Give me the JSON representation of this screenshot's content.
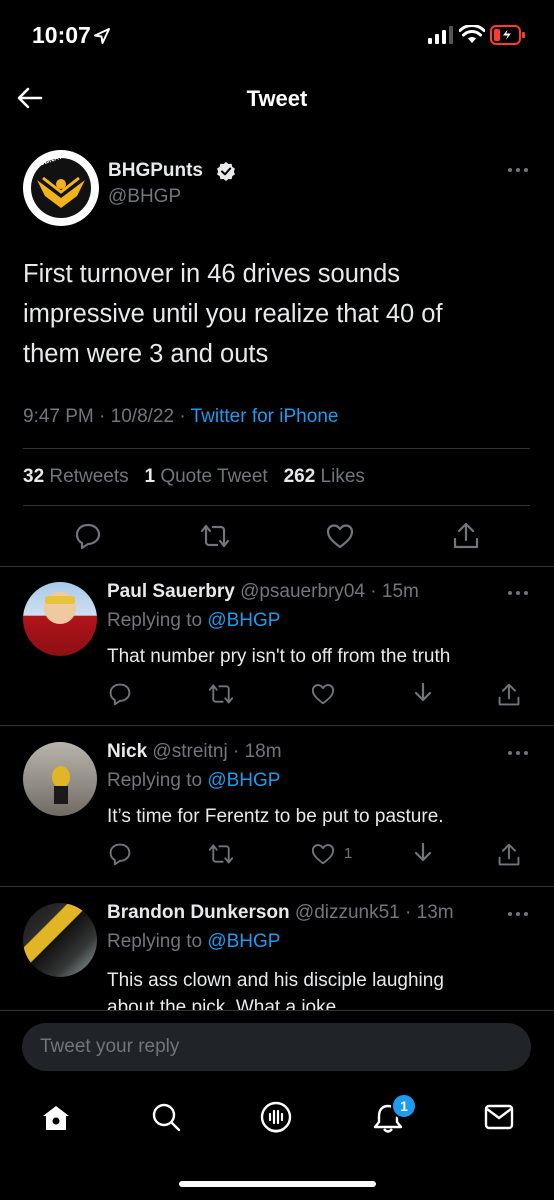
{
  "status": {
    "time": "10:07"
  },
  "header": {
    "title": "Tweet"
  },
  "tweet": {
    "display_name": "BHGPunts",
    "handle": "@BHGP",
    "avatar_text": "SBNATION",
    "text_lines": [
      "First turnover in 46 drives sounds",
      "impressive until you realize that 40 of",
      "them were 3 and outs"
    ],
    "time": "9:47 PM",
    "date": "10/8/22",
    "source": "Twitter for iPhone",
    "retweets_count": "32",
    "retweets_label": "Retweets",
    "quotes_count": "1",
    "quotes_label": "Quote Tweet",
    "likes_count": "262",
    "likes_label": "Likes"
  },
  "replies": [
    {
      "name": "Paul Sauerbry",
      "handle": "@psauerbry04",
      "time": "15m",
      "replying_label": "Replying to",
      "replying_to": "@BHGP",
      "text": "That number pry isn't to off from the truth",
      "likes": ""
    },
    {
      "name": "Nick",
      "handle": "@streitnj",
      "time": "18m",
      "replying_label": "Replying to",
      "replying_to": "@BHGP",
      "text": "It’s time for Ferentz to be put to pasture.",
      "likes": "1"
    },
    {
      "name": "Brandon Dunkerson",
      "handle": "@dizzunk51",
      "time": "13m",
      "replying_label": "Replying to",
      "replying_to": "@BHGP",
      "text_lines": [
        "This ass clown and his disciple laughing",
        "about the pick. What a joke"
      ]
    }
  ],
  "compose": {
    "placeholder": "Tweet your reply"
  },
  "tabbar": {
    "notifications_badge": "1"
  },
  "colors": {
    "background": "#000000",
    "accent": "#1d9bf0",
    "muted": "#71767b",
    "battery_low": "#ff3b30"
  }
}
